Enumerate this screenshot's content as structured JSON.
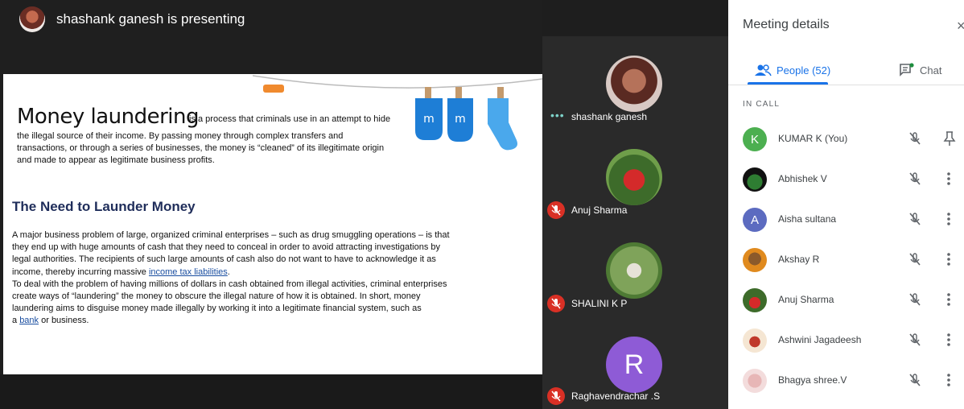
{
  "presenter": {
    "title": "shashank ganesh is presenting"
  },
  "slide": {
    "heading": "Money laundering",
    "intro_tail": "is a process that criminals use in an attempt to hide",
    "intro_lines": [
      "the illegal source of their income. By passing money through complex transfers and",
      "transactions, or through a series of businesses, the money is “cleaned” of its illegitimate origin",
      "and made to appear as legitimate business profits."
    ],
    "subheading": "The Need to Launder Money",
    "body_line1": "A major business problem of large, organized criminal enterprises – such as drug smuggling operations – is that",
    "body_line2": "they end up with huge amounts of cash that they need to conceal in order to avoid attracting investigations by",
    "body_line3": "legal authorities. The recipients of such large amounts of cash also do not want to have to acknowledge it as",
    "body_line4_prefix": "income, thereby incurring massive ",
    "body_line4_link": "income tax liabilities",
    "body_line4_suffix": ".",
    "body_line5": "To deal with the problem of having millions of dollars in cash obtained from illegal activities, criminal enterprises",
    "body_line6": "create ways of “laundering” the money to obscure the illegal nature of how it is obtained. In short, money",
    "body_line7": "laundering aims to disguise money made illegally by working it into a legitimate financial system, such as",
    "body_line8_prefix": "a ",
    "body_line8_link": "bank",
    "body_line8_suffix": " or business."
  },
  "tiles": [
    {
      "name": "shashank ganesh",
      "status": "speaking"
    },
    {
      "name": "Anuj Sharma",
      "status": "muted"
    },
    {
      "name": "SHALINI K P",
      "status": "muted"
    },
    {
      "name": "Raghavendrachar .S",
      "status": "muted",
      "initial": "R",
      "color": "#8e5bd6"
    }
  ],
  "panel": {
    "title": "Meeting details",
    "close": "×",
    "tab_people": "People (52)",
    "tab_chat": "Chat",
    "section_label": "IN CALL",
    "people": [
      {
        "name": "KUMAR K (You)",
        "initial": "K",
        "color": "#4caf50"
      },
      {
        "name": "Abhishek V"
      },
      {
        "name": "Aisha sultana",
        "initial": "A",
        "color": "#5c6bc0"
      },
      {
        "name": "Akshay R"
      },
      {
        "name": "Anuj Sharma"
      },
      {
        "name": "Ashwini Jagadeesh"
      },
      {
        "name": "Bhagya shree.V"
      }
    ]
  },
  "colors": {
    "accent": "#1a73e8",
    "muted": "#d93025",
    "heading_navy": "#1f2d5a"
  }
}
